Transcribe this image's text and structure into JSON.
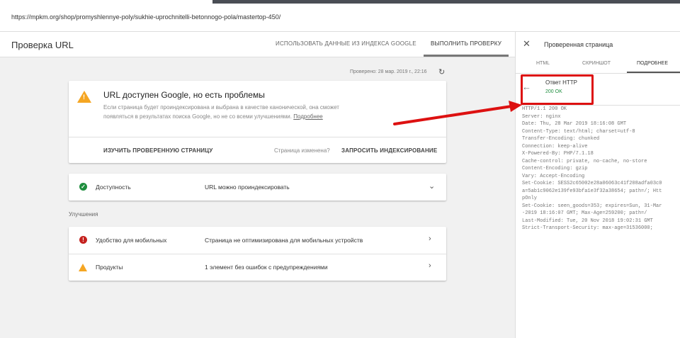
{
  "url": "https://mpkm.org/shop/promyshlennye-poly/sukhie-uprochnitelli-betonnogo-pola/mastertop-450/",
  "header": {
    "title": "Проверка URL",
    "tabs": [
      "ИСПОЛЬЗОВАТЬ ДАННЫЕ ИЗ ИНДЕКСА GOOGLE",
      "ВЫПОЛНИТЬ ПРОВЕРКУ"
    ]
  },
  "checked": "Проверено: 28 мар. 2019 г., 22:16",
  "status_card": {
    "title": "URL доступен Google, но есть проблемы",
    "desc": "Если страница будет проиндексирована и выбрана в качестве канонической, она сможет появляться в результатах поиска Google, но не со всеми улучшениями.",
    "link": "Подробнее",
    "explore": "ИЗУЧИТЬ ПРОВЕРЕННУЮ СТРАНИЦУ",
    "changed": "Страница изменена?",
    "request": "ЗАПРОСИТЬ ИНДЕКСИРОВАНИЕ"
  },
  "availability": {
    "label": "Доступность",
    "value": "URL можно проиндексировать"
  },
  "improvements": {
    "heading": "Улучшения",
    "items": [
      {
        "label": "Удобство для мобильных",
        "value": "Страница не оптимизирована для мобильных устройств"
      },
      {
        "label": "Продукты",
        "value": "1 элемент без ошибок с предупреждениями"
      }
    ]
  },
  "panel": {
    "title": "Проверенная страница",
    "tabs": [
      "HTML",
      "СКРИНШОТ",
      "ПОДРОБНЕЕ"
    ],
    "section": "Ответ HTTP",
    "status": "200 OK",
    "headers": "HTTP/1.1 200 OK\nServer: nginx\nDate: Thu, 28 Mar 2019 18:16:08 GMT\nContent-Type: text/html; charset=utf-8\nTransfer-Encoding: chunked\nConnection: keep-alive\nX-Powered-By: PHP/7.1.18\nCache-control: private, no-cache, no-store\nContent-Encoding: gzip\nVary: Accept-Encoding\nSet-Cookie: SESS2c65002e28a06063c41f208adfa03c0\na=5ab1c9062e139fe93bfa1e3f32a38654; path=/; Htt\npOnly\nSet-Cookie: seen_goods=353; expires=Sun, 31-Mar\n-2019 18:16:07 GMT; Max-Age=259200; path=/\nLast-Modified: Tue, 20 Nov 2018 19:02:31 GMT\nStrict-Transport-Security: max-age=31536000;"
  },
  "colors": {
    "annotation": "#dd1111",
    "warning": "#f5a623",
    "ok": "#1e8e3e",
    "error": "#c5221f"
  }
}
